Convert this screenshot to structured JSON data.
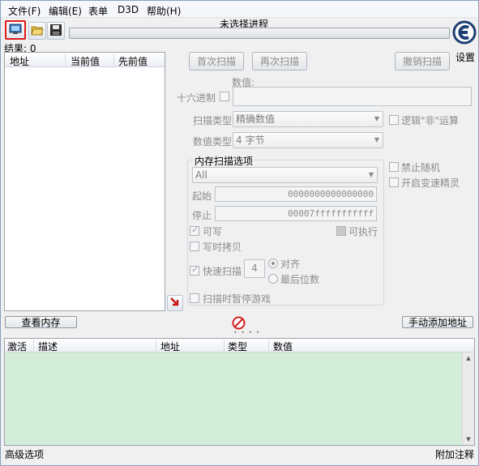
{
  "menu": [
    "文件(F)",
    "编辑(E)",
    "表单",
    "D3D",
    "帮助(H)"
  ],
  "process_title": "未选择进程",
  "logo_label": "设置",
  "results_label": "结果: 0",
  "columns": {
    "address": "地址",
    "current": "当前值",
    "previous": "先前值"
  },
  "buttons": {
    "first_scan": "首次扫描",
    "next_scan": "再次扫描",
    "undo_scan": "撤销扫描",
    "memory_view": "查看内存",
    "add_address": "手动添加地址"
  },
  "value_label": "数值:",
  "hex_label": "十六进制",
  "scan_type": {
    "label": "扫描类型",
    "value": "精确数值"
  },
  "value_type": {
    "label": "数值类型",
    "value": "4 字节"
  },
  "not_logic": "逻辑\"非\"运算",
  "mem_options": {
    "title": "内存扫描选项",
    "region": "All",
    "start_label": "起始",
    "start_value": "0000000000000000",
    "stop_label": "停止",
    "stop_value": "00007fffffffffff",
    "writable": "可写",
    "executable": "可执行",
    "copy_on_write": "写时拷贝",
    "fast_scan": "快速扫描",
    "fast_scan_value": "4",
    "align": "对齐",
    "last_digits": "最后位数",
    "pause_game": "扫描时暂停游戏"
  },
  "disable_random": "禁止随机",
  "speedhack": "开启变速精灵",
  "cheat_columns": {
    "active": "激活",
    "description": "描述",
    "address": "地址",
    "type": "类型",
    "value": "数值"
  },
  "status": {
    "left": "高级选项",
    "right": "附加注释"
  },
  "colors": {
    "cheat_table_bg": "#d4edd9",
    "highlight": "#e01a1a"
  }
}
